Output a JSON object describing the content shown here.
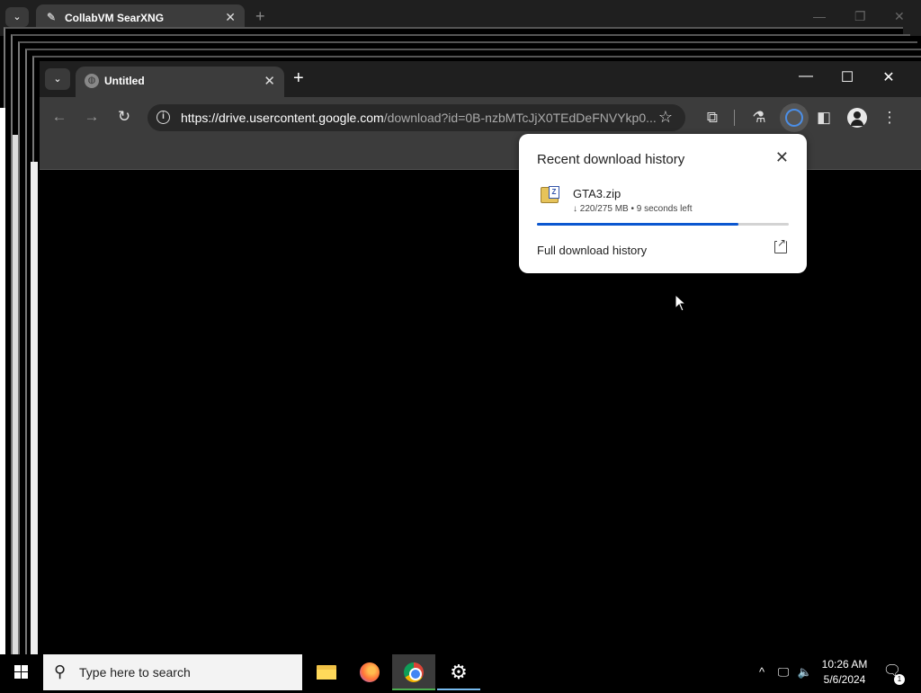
{
  "back_window": {
    "tab_title": "CollabVM SearXNG",
    "close_glyph": "✕",
    "new_tab_glyph": "+"
  },
  "window": {
    "tab_title": "Untitled",
    "tab_close_glyph": "✕",
    "new_tab_glyph": "+",
    "minimize_glyph": "—",
    "maximize_glyph": "☐",
    "close_glyph": "✕"
  },
  "toolbar": {
    "back_glyph": "←",
    "forward_glyph": "→",
    "reload_glyph": "↻",
    "url_host": "https://drive.usercontent.google.com",
    "url_path": "/download?id=0B-nzbMTcJjX0TEdDeFNVYkp0...",
    "star_glyph": "☆"
  },
  "download_bubble": {
    "heading": "Recent download history",
    "close_glyph": "✕",
    "file_name": "GTA3.zip",
    "status": "↓ 220/275 MB • 9 seconds left",
    "progress": 0.8,
    "full_history_link": "Full download history",
    "progress_color": "#0b57d0"
  },
  "taskbar": {
    "search_placeholder": "Type here to search",
    "time": "10:26 AM",
    "date": "5/6/2024",
    "notification_count": "1"
  }
}
